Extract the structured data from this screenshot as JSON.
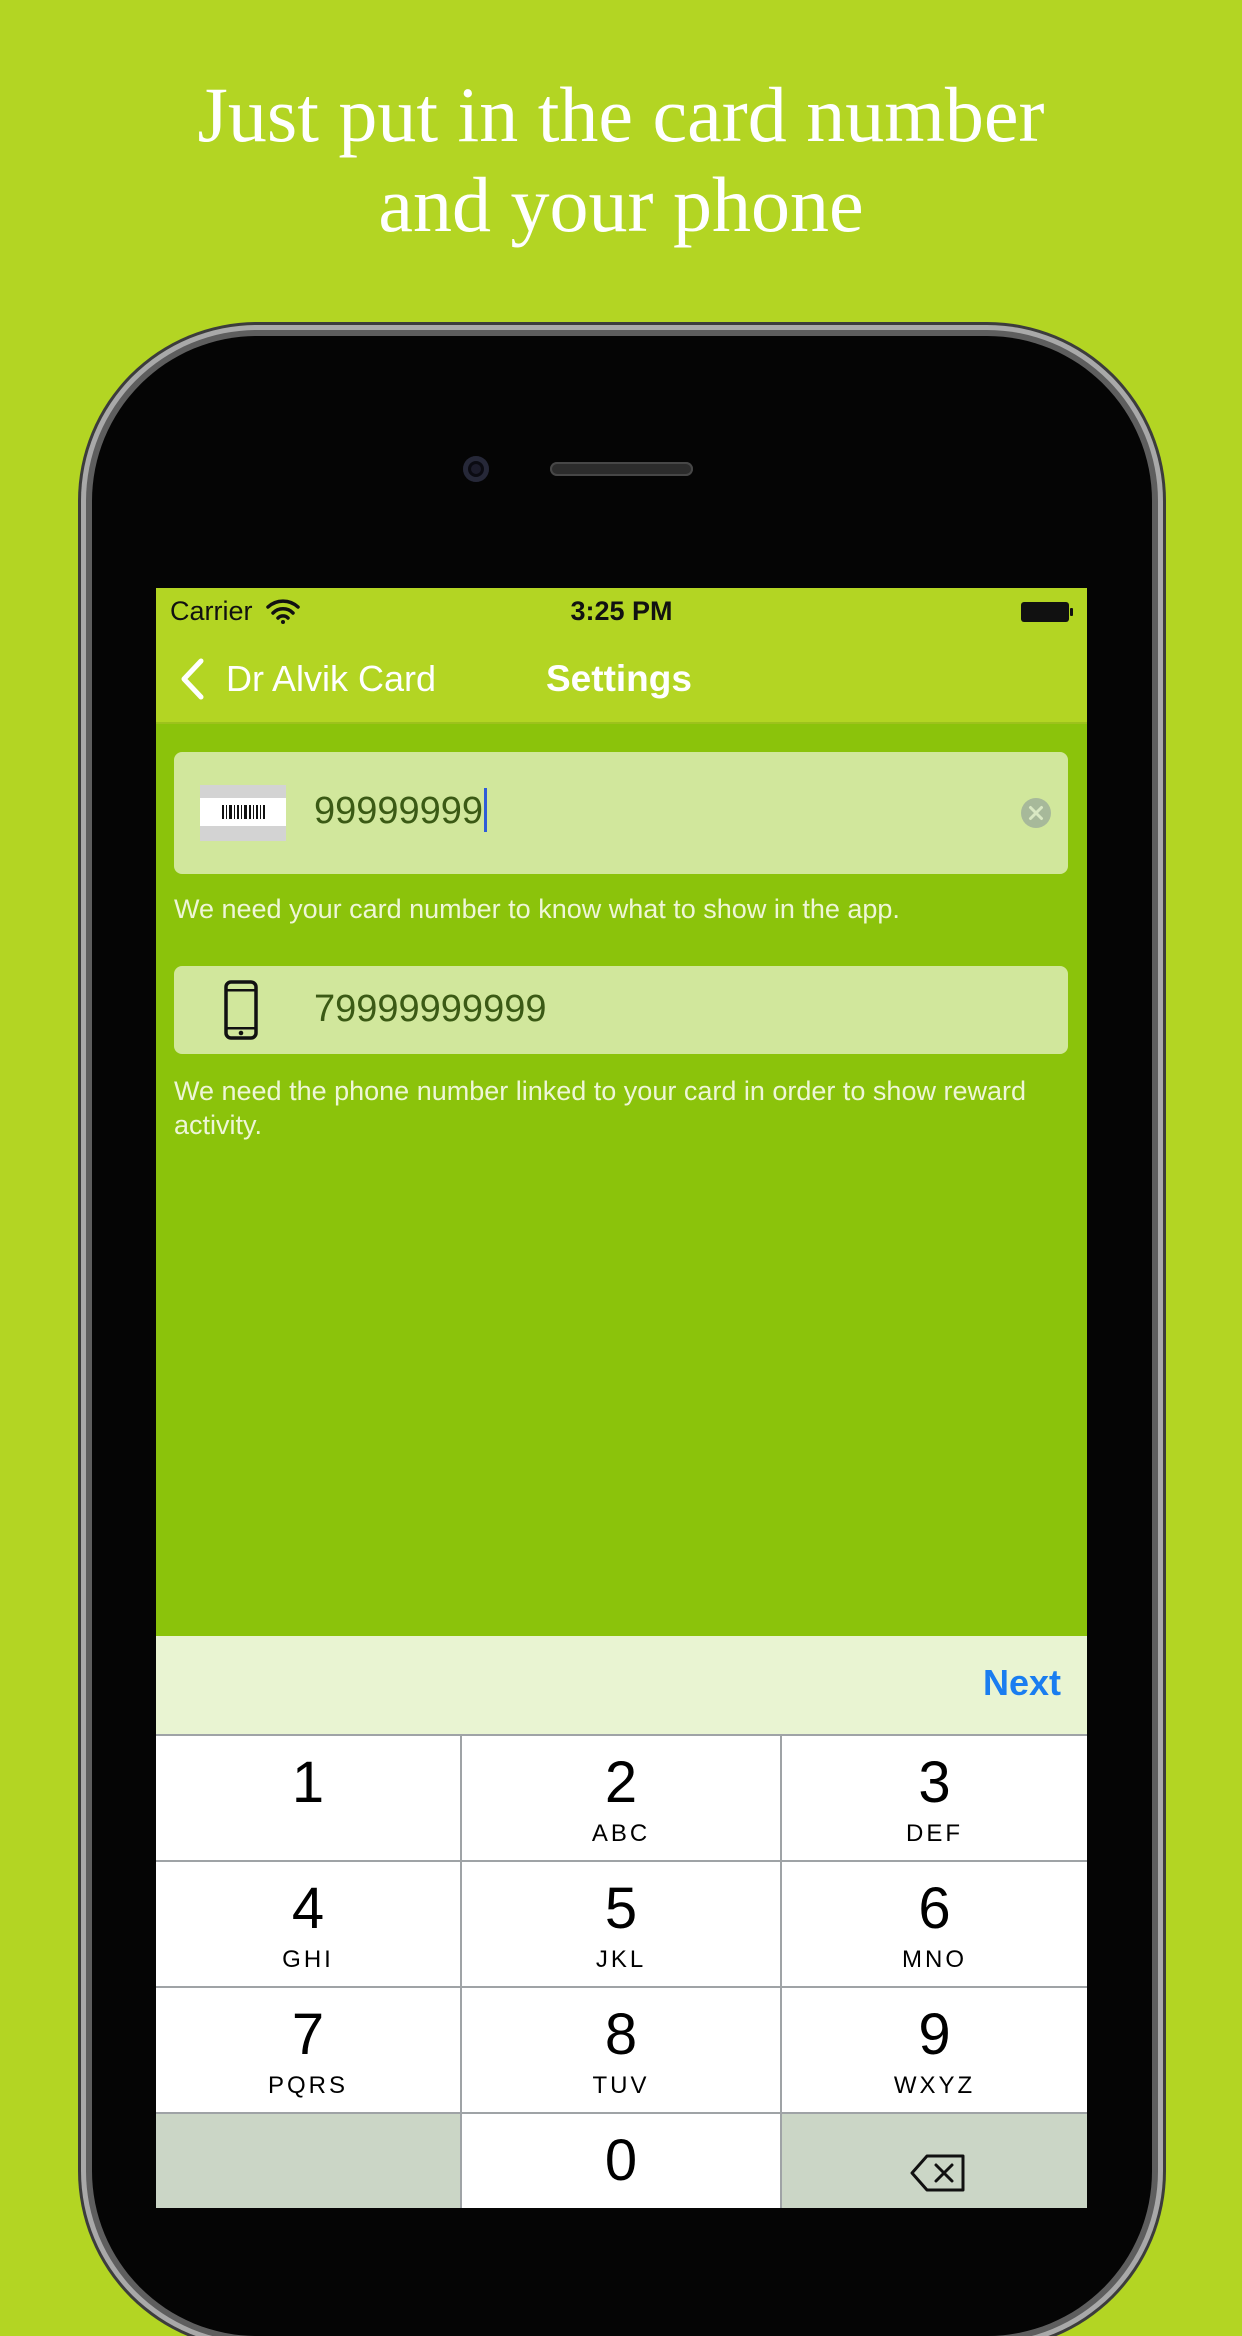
{
  "headline": {
    "line1": "Just put in the card number",
    "line2": "and your phone"
  },
  "status_bar": {
    "carrier": "Carrier",
    "time": "3:25 PM"
  },
  "nav": {
    "back_label": "Dr Alvik Card",
    "title": "Settings"
  },
  "card_field": {
    "value": "99999999",
    "hint": "We need your card number to know what to show in the app."
  },
  "phone_field": {
    "value": "79999999999",
    "hint": "We need the phone number linked to your card in order to show reward activity."
  },
  "accessory": {
    "next_label": "Next"
  },
  "keypad": {
    "keys": [
      {
        "num": "1",
        "letters": ""
      },
      {
        "num": "2",
        "letters": "ABC"
      },
      {
        "num": "3",
        "letters": "DEF"
      },
      {
        "num": "4",
        "letters": "GHI"
      },
      {
        "num": "5",
        "letters": "JKL"
      },
      {
        "num": "6",
        "letters": "MNO"
      },
      {
        "num": "7",
        "letters": "PQRS"
      },
      {
        "num": "8",
        "letters": "TUV"
      },
      {
        "num": "9",
        "letters": "WXYZ"
      },
      {
        "num": "0",
        "letters": ""
      }
    ]
  },
  "colors": {
    "background": "#b3d523",
    "screen": "#8bc30b",
    "field": "#d1e79c",
    "accent": "#1a7df0"
  }
}
